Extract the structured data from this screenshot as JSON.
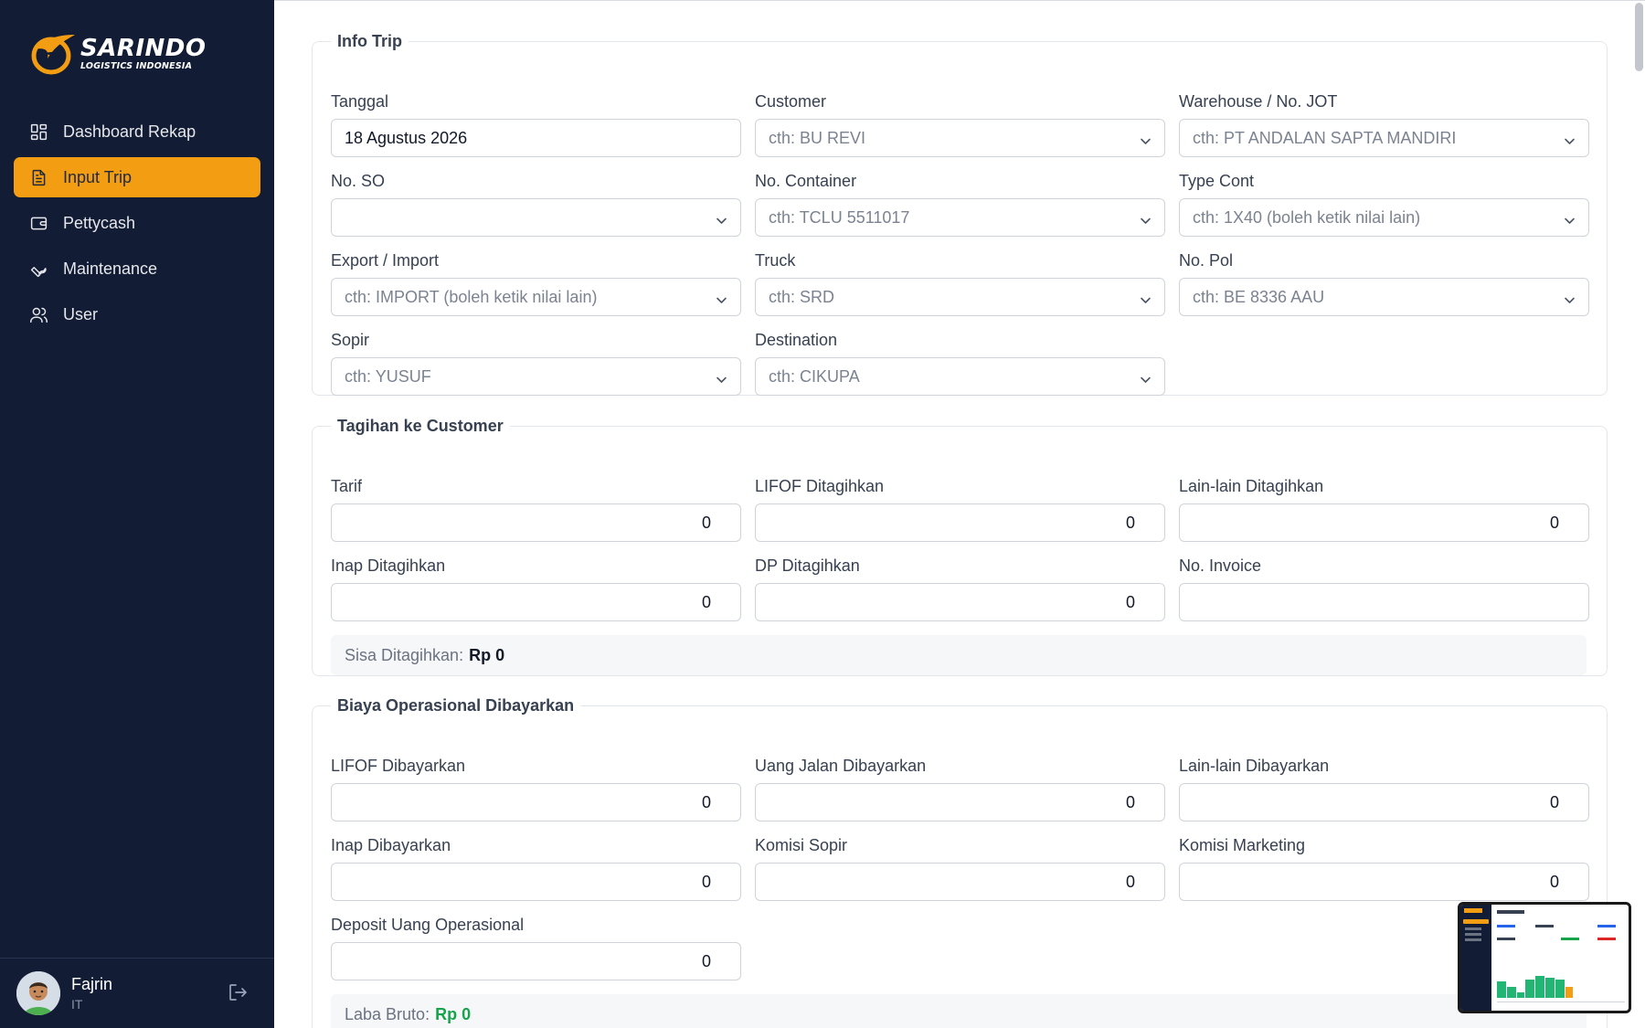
{
  "brand": {
    "title": "SARINDO",
    "subtitle": "LOGISTICS INDONESIA",
    "accent_color": "#f29d12",
    "sidebar_bg": "#131c35"
  },
  "nav": [
    {
      "label": "Dashboard Rekap",
      "icon": "dashboard-grid-icon",
      "active": false
    },
    {
      "label": "Input Trip",
      "icon": "document-icon",
      "active": true
    },
    {
      "label": "Pettycash",
      "icon": "wallet-icon",
      "active": false
    },
    {
      "label": "Maintenance",
      "icon": "wrench-icon",
      "active": false
    },
    {
      "label": "User",
      "icon": "users-icon",
      "active": false
    }
  ],
  "user": {
    "name": "Fajrin",
    "role": "IT"
  },
  "info_trip": {
    "legend": "Info Trip",
    "tanggal": {
      "label": "Tanggal",
      "value": "18 Agustus 2026"
    },
    "customer": {
      "label": "Customer",
      "placeholder": "cth: BU REVI"
    },
    "warehouse": {
      "label": "Warehouse / No. JOT",
      "placeholder": "cth: PT ANDALAN SAPTA MANDIRI"
    },
    "no_so": {
      "label": "No. SO",
      "value": ""
    },
    "no_container": {
      "label": "No. Container",
      "placeholder": "cth: TCLU 5511017"
    },
    "type_cont": {
      "label": "Type Cont",
      "placeholder": "cth: 1X40 (boleh ketik nilai lain)"
    },
    "export_import": {
      "label": "Export / Import",
      "placeholder": "cth: IMPORT (boleh ketik nilai lain)"
    },
    "truck": {
      "label": "Truck",
      "placeholder": "cth: SRD"
    },
    "no_pol": {
      "label": "No. Pol",
      "placeholder": "cth: BE 8336 AAU"
    },
    "sopir": {
      "label": "Sopir",
      "placeholder": "cth: YUSUF"
    },
    "destination": {
      "label": "Destination",
      "placeholder": "cth: CIKUPA"
    }
  },
  "tagihan": {
    "legend": "Tagihan ke Customer",
    "tarif": {
      "label": "Tarif",
      "value": "0"
    },
    "lifof": {
      "label": "LIFOF Ditagihkan",
      "value": "0"
    },
    "lainlain": {
      "label": "Lain-lain Ditagihkan",
      "value": "0"
    },
    "inap": {
      "label": "Inap Ditagihkan",
      "value": "0"
    },
    "dp": {
      "label": "DP Ditagihkan",
      "value": "0"
    },
    "no_invoice": {
      "label": "No. Invoice",
      "value": ""
    },
    "sisa_label": "Sisa Ditagihkan:",
    "sisa_value": "Rp 0"
  },
  "biaya": {
    "legend": "Biaya Operasional Dibayarkan",
    "lifof": {
      "label": "LIFOF Dibayarkan",
      "value": "0"
    },
    "uang_jalan": {
      "label": "Uang Jalan Dibayarkan",
      "value": "0"
    },
    "lainlain": {
      "label": "Lain-lain Dibayarkan",
      "value": "0"
    },
    "inap": {
      "label": "Inap Dibayarkan",
      "value": "0"
    },
    "komisi_sopir": {
      "label": "Komisi Sopir",
      "value": "0"
    },
    "komisi_marketing": {
      "label": "Komisi Marketing",
      "value": "0"
    },
    "deposit": {
      "label": "Deposit Uang Operasional",
      "value": "0"
    },
    "laba_label": "Laba Bruto:",
    "laba_value": "Rp 0"
  }
}
